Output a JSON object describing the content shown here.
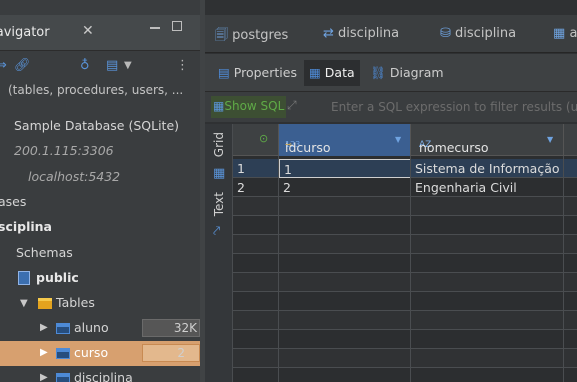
{
  "navigator": {
    "title": "Navigator",
    "close_glyph": "✕",
    "filter_text": "(tables, procedures, users, ...",
    "tree": [
      {
        "label": "Sample Database (SQLite)",
        "style": "normal"
      },
      {
        "label": "200.1.115:3306",
        "style": "italic"
      },
      {
        "label": "localhost:5432",
        "style": "italic"
      },
      {
        "label": "ases",
        "style": "normal"
      },
      {
        "label": "sciplina",
        "style": "bold"
      },
      {
        "label": "Schemas",
        "style": "normal"
      },
      {
        "label": "public",
        "style": "bold"
      },
      {
        "label": "Tables",
        "style": "normal"
      },
      {
        "label": "aluno",
        "size": "32K"
      },
      {
        "label": "curso",
        "size": "2"
      },
      {
        "label": "disciplina"
      }
    ]
  },
  "editor": {
    "tabs": [
      "postgres",
      "disciplina",
      "disciplina",
      "a"
    ],
    "subtabs": {
      "properties": "Properties",
      "data": "Data",
      "diagram": "Diagram"
    },
    "show_sql": "Show SQL",
    "filter_placeholder": "Enter a SQL expression to filter results (u",
    "side_tabs": {
      "grid": "Grid",
      "text": "Text"
    },
    "columns": [
      {
        "type_badge": "123",
        "name": "idcurso",
        "key_badge": "⊸"
      },
      {
        "type_badge": "AZ",
        "name": "nomecurso"
      }
    ],
    "rows": [
      {
        "num": "1",
        "idcurso": "1",
        "nomecurso": "Sistema de Informação"
      },
      {
        "num": "2",
        "idcurso": "2",
        "nomecurso": "Engenharia Civil"
      }
    ]
  }
}
